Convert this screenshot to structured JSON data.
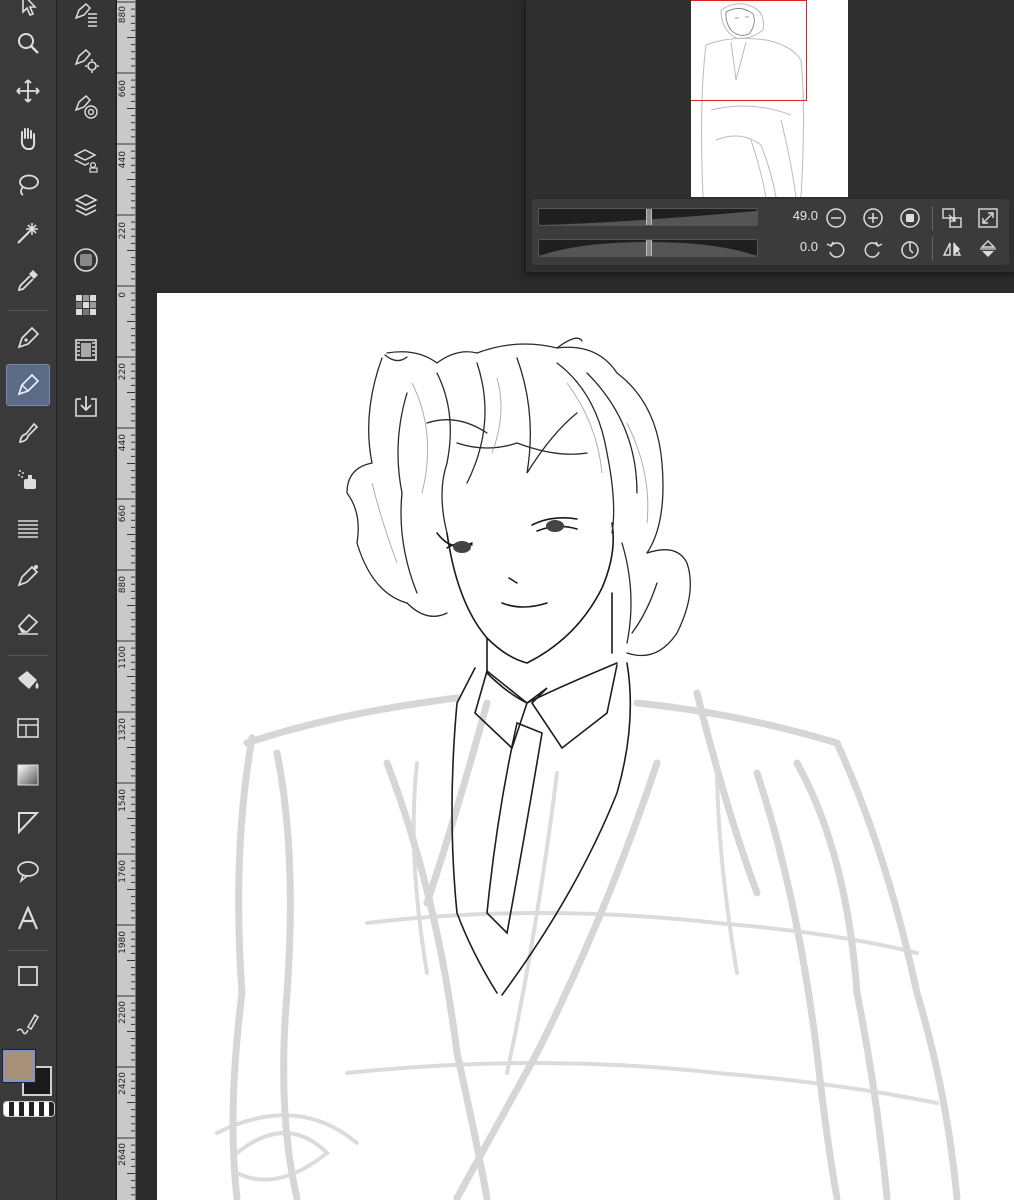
{
  "toolbar": {
    "tools": [
      "cursor-icon",
      "zoom-icon",
      "move-icon",
      "hand-icon",
      "lasso-select-icon",
      "magic-wand-icon",
      "eyedropper-icon",
      "pen-icon",
      "pencil-icon",
      "brush-icon",
      "airbrush-icon",
      "decoration-icon",
      "blend-icon",
      "eraser-icon",
      "fill-icon",
      "frame-icon",
      "gradient-icon",
      "ruler-icon",
      "balloon-icon",
      "text-icon",
      "shape-icon",
      "correct-line-icon"
    ],
    "active_tool": "pencil-icon"
  },
  "subbar": {
    "items": [
      "sub-tool-layer-icon",
      "sub-tool-settings-icon",
      "sub-tool-target-icon",
      "layer-properties-icon",
      "layer-stack-icon",
      "material-icon",
      "color-set-icon",
      "animation-icon",
      "import-icon"
    ]
  },
  "ruler": {
    "labels": [
      "880",
      "660",
      "440",
      "220",
      "0",
      "220",
      "440",
      "660",
      "880",
      "1100",
      "1320",
      "1540",
      "1760",
      "1980",
      "2200",
      "2420",
      "2640"
    ]
  },
  "navigator": {
    "zoom_value": "49.0",
    "zoom_level": 0.5,
    "rotation_value": "0.0",
    "rotation_level": 0.5
  },
  "colors": {
    "main": "#a89078",
    "sub": "#1a1a1a",
    "accent": "#5b6a86",
    "frame": "#dd2222"
  }
}
